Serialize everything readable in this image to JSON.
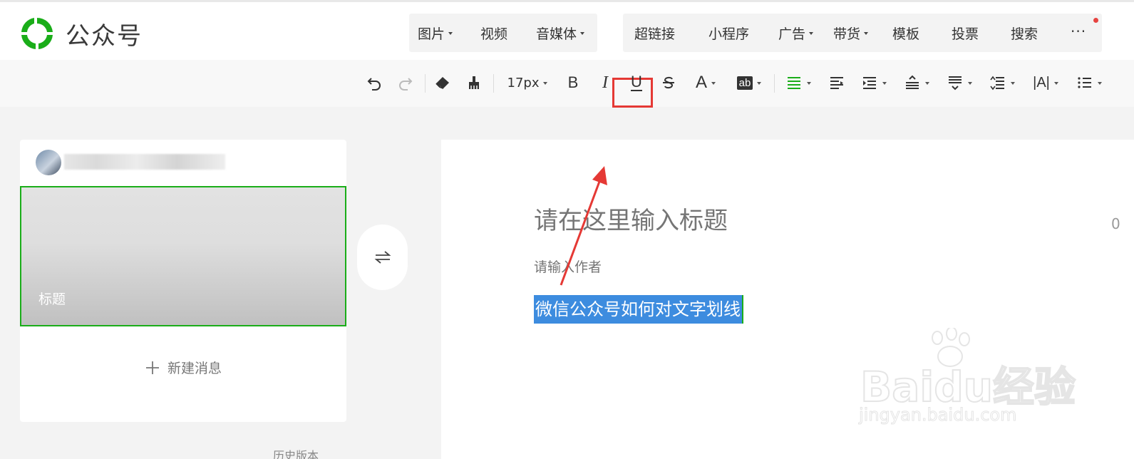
{
  "header": {
    "brand": "公众号",
    "menu_group_1": [
      {
        "label": "图片",
        "dropdown": true
      },
      {
        "label": "视频",
        "dropdown": false
      },
      {
        "label": "音媒体",
        "dropdown": true
      }
    ],
    "menu_group_2": [
      {
        "label": "超链接",
        "dropdown": false
      },
      {
        "label": "小程序",
        "dropdown": false
      },
      {
        "label": "广告",
        "dropdown": true
      },
      {
        "label": "带货",
        "dropdown": true
      },
      {
        "label": "模板",
        "dropdown": false
      },
      {
        "label": "投票",
        "dropdown": false
      },
      {
        "label": "搜索",
        "dropdown": false
      }
    ],
    "more_label": "···"
  },
  "toolbar": {
    "font_size": "17px",
    "bold_label": "B",
    "italic_label": "I",
    "underline_label": "U",
    "font_color_label": "A",
    "bg_color_label": "ab",
    "letter_spacing_label": "|A|"
  },
  "sidebar": {
    "cover_title": "标题",
    "new_message_label": "新建消息",
    "history_label": "历史版本"
  },
  "editor": {
    "title_placeholder": "请在这里输入标题",
    "title_counter": "0",
    "author_placeholder": "请输入作者",
    "selected_text": "微信公众号如何对文字划线"
  },
  "watermark": {
    "main": "Baidu经验",
    "sub": "jingyan.baidu.com"
  },
  "colors": {
    "accent_green": "#1aad19",
    "selection_blue": "#3d8cdf",
    "highlight_red": "#e53935"
  }
}
